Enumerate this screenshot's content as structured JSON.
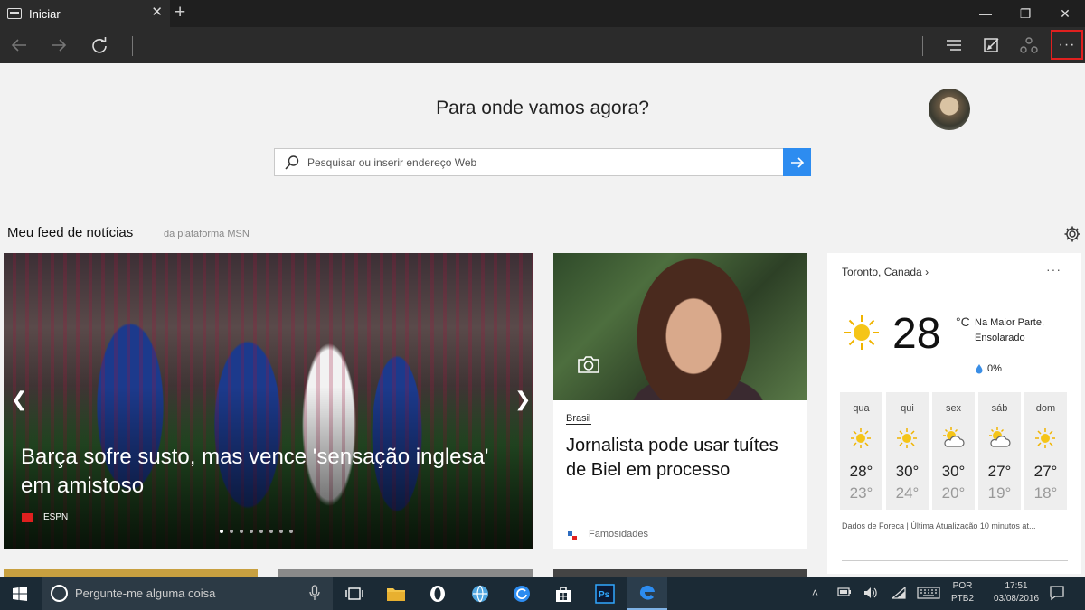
{
  "browser": {
    "tab_title": "Iniciar",
    "tab_close": "✕",
    "new_tab": "+",
    "window_controls": {
      "minimize": "—",
      "restore": "❐",
      "close": "✕"
    },
    "more_label": "···"
  },
  "start": {
    "heading": "Para onde vamos agora?",
    "search_placeholder": "Pesquisar ou inserir endereço Web"
  },
  "feed": {
    "title": "Meu feed de notícias",
    "subtitle": "da plataforma MSN",
    "hero": {
      "title": "Barça sofre susto, mas vence 'sensação inglesa' em amistoso",
      "source": "ESPN",
      "slide_count": 8,
      "active_slide": 1,
      "prev": "❮",
      "next": "❯"
    },
    "card": {
      "category": "Brasil",
      "title": "Jornalista pode usar tuítes de Biel em processo",
      "source": "Famosidades"
    }
  },
  "weather": {
    "location": "Toronto, Canada",
    "more": "···",
    "temperature": "28",
    "unit": "°C",
    "condition": "Na Maior Parte, Ensolarado",
    "precip": "0%",
    "days": [
      {
        "name": "qua",
        "icon": "sun-icon",
        "high": "28°",
        "low": "23°"
      },
      {
        "name": "qui",
        "icon": "sun-icon",
        "high": "30°",
        "low": "24°"
      },
      {
        "name": "sex",
        "icon": "partly-cloudy-icon",
        "high": "30°",
        "low": "20°"
      },
      {
        "name": "sáb",
        "icon": "partly-cloudy-icon",
        "high": "27°",
        "low": "19°"
      },
      {
        "name": "dom",
        "icon": "sun-icon",
        "high": "27°",
        "low": "18°"
      }
    ],
    "footer": "Dados de Foreca | Última Atualização 10 minutos at..."
  },
  "taskbar": {
    "search_placeholder": "Pergunte-me alguma coisa",
    "lang_line1": "POR",
    "lang_line2": "PTB2",
    "time": "17:51",
    "date": "03/08/2016"
  },
  "colors": {
    "accent": "#2d8cf0",
    "highlight_border": "#e0201f",
    "taskbar": "#1b2a35"
  }
}
